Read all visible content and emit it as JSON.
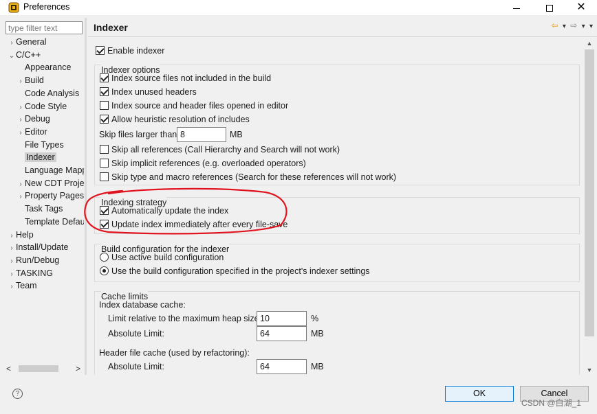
{
  "window": {
    "title": "Preferences",
    "minimize": "",
    "maximize": "",
    "close": "✕"
  },
  "sidebar": {
    "filter_placeholder": "type filter text",
    "items": [
      {
        "label": "General",
        "arrow": "›",
        "indent": 0
      },
      {
        "label": "C/C++",
        "arrow": "⌄",
        "indent": 0
      },
      {
        "label": "Appearance",
        "arrow": "",
        "indent": 1
      },
      {
        "label": "Build",
        "arrow": "›",
        "indent": 1
      },
      {
        "label": "Code Analysis",
        "arrow": "",
        "indent": 1
      },
      {
        "label": "Code Style",
        "arrow": "›",
        "indent": 1
      },
      {
        "label": "Debug",
        "arrow": "›",
        "indent": 1
      },
      {
        "label": "Editor",
        "arrow": "›",
        "indent": 1
      },
      {
        "label": "File Types",
        "arrow": "",
        "indent": 1
      },
      {
        "label": "Indexer",
        "arrow": "",
        "indent": 1,
        "selected": true
      },
      {
        "label": "Language Mapp",
        "arrow": "",
        "indent": 1
      },
      {
        "label": "New CDT Projec",
        "arrow": "›",
        "indent": 1
      },
      {
        "label": "Property Pages",
        "arrow": "›",
        "indent": 1
      },
      {
        "label": "Task Tags",
        "arrow": "",
        "indent": 1
      },
      {
        "label": "Template Defau",
        "arrow": "",
        "indent": 1
      },
      {
        "label": "Help",
        "arrow": "›",
        "indent": 0
      },
      {
        "label": "Install/Update",
        "arrow": "›",
        "indent": 0
      },
      {
        "label": "Run/Debug",
        "arrow": "›",
        "indent": 0
      },
      {
        "label": "TASKING",
        "arrow": "›",
        "indent": 0
      },
      {
        "label": "Team",
        "arrow": "›",
        "indent": 0
      }
    ],
    "scroll_left": "<",
    "scroll_right": ">"
  },
  "page": {
    "title": "Indexer",
    "nav_back": "⇦",
    "nav_back_menu": "▾",
    "nav_forward": "⇨",
    "nav_forward_menu": "▾",
    "view_menu": "▾"
  },
  "indexer": {
    "enable_indexer": {
      "label": "Enable indexer",
      "checked": true
    },
    "options": {
      "title": "Indexer options",
      "index_not_in_build": {
        "label": "Index source files not included in the build",
        "checked": true
      },
      "index_unused_headers": {
        "label": "Index unused headers",
        "checked": true
      },
      "index_opened_in_editor": {
        "label": "Index source and header files opened in editor",
        "checked": false
      },
      "heuristic_includes": {
        "label": "Allow heuristic resolution of includes",
        "checked": true
      },
      "skip_files_label": "Skip files larger than:",
      "skip_files_value": "8",
      "skip_files_unit": "MB",
      "skip_all_references": {
        "label": "Skip all references (Call Hierarchy and Search will not work)",
        "checked": false
      },
      "skip_implicit_references": {
        "label": "Skip implicit references (e.g. overloaded operators)",
        "checked": false
      },
      "skip_type_macro_references": {
        "label": "Skip type and macro references (Search for these references will not work)",
        "checked": false
      }
    },
    "strategy": {
      "title": "Indexing strategy",
      "auto_update": {
        "label": "Automatically update the index",
        "checked": true
      },
      "update_on_save": {
        "label": "Update index immediately after every file-save",
        "checked": true
      }
    },
    "build_config": {
      "title": "Build configuration for the indexer",
      "use_active": {
        "label": "Use active build configuration",
        "selected": false
      },
      "use_project_specified": {
        "label": "Use the build configuration specified in the project's indexer settings",
        "selected": true
      }
    },
    "cache": {
      "title": "Cache limits",
      "index_db_cache_label": "Index database cache:",
      "heap_limit_label": "Limit relative to the maximum heap size:",
      "heap_limit_value": "10",
      "heap_limit_unit": "%",
      "absolute_limit_label": "Absolute Limit:",
      "absolute_limit_value": "64",
      "absolute_limit_unit": "MB",
      "header_cache_label": "Header file cache (used by refactoring):",
      "header_absolute_label": "Absolute Limit:",
      "header_absolute_value": "64",
      "header_absolute_unit": "MB"
    }
  },
  "footer": {
    "help": "?",
    "ok": "OK",
    "cancel": "Cancel",
    "watermark": "CSDN @白湖_1"
  },
  "colors": {
    "annotation_red": "#e0141e",
    "ok_border": "#0078d7",
    "app_icon": "#f2b316"
  }
}
